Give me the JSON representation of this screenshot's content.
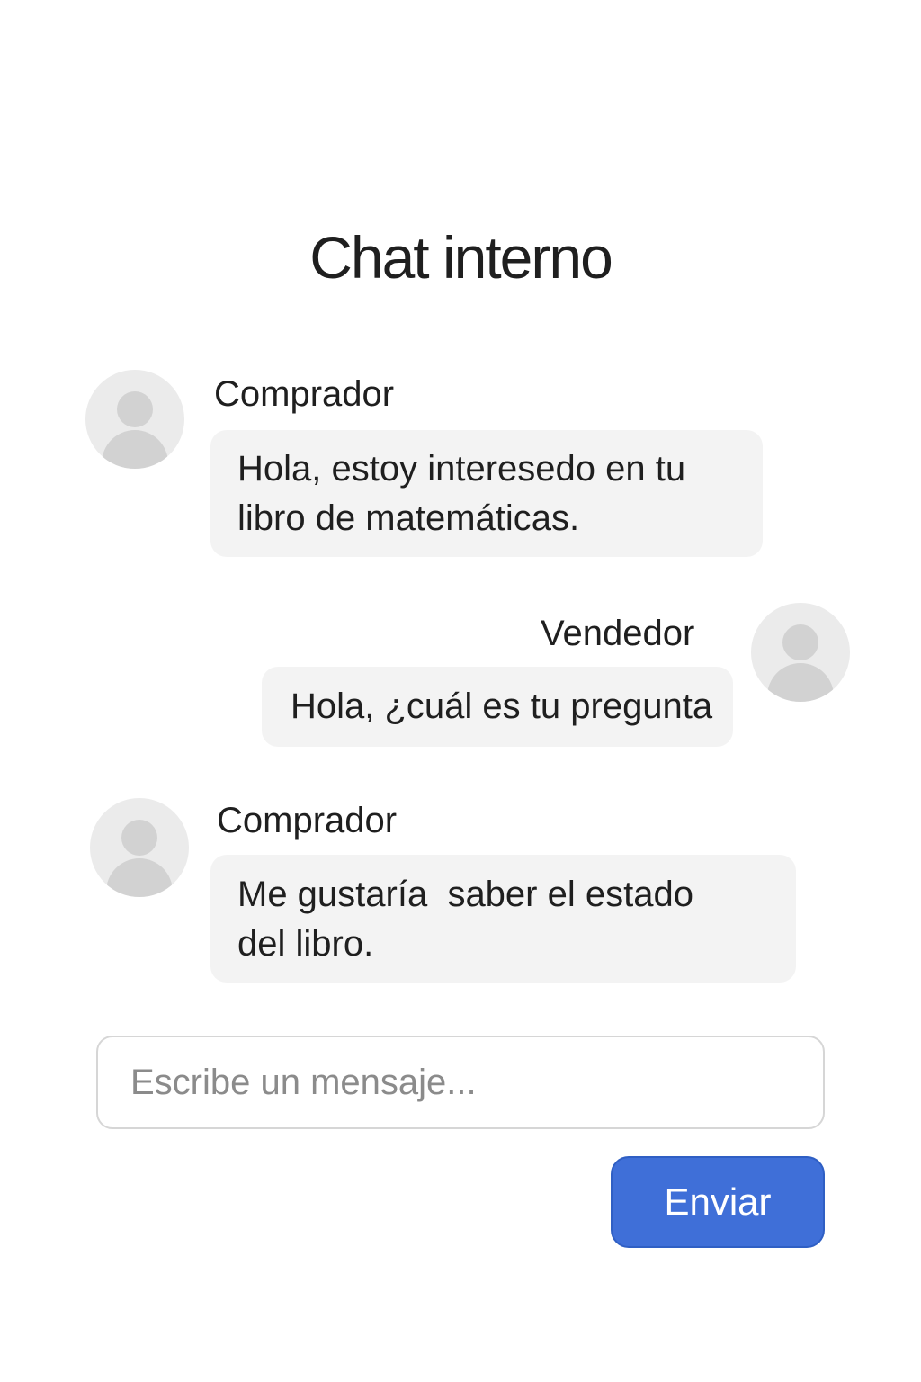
{
  "header": {
    "title": "Chat interno"
  },
  "messages": [
    {
      "sender": "Comprador",
      "side": "left",
      "lines": [
        "Hola, estoy interesedo en tu",
        "libro de matemáticas."
      ],
      "avatar_icon": "user-avatar-icon"
    },
    {
      "sender": "Vendedor",
      "side": "right",
      "lines": [
        "Hola, ¿cuál es tu pregunta"
      ],
      "avatar_icon": "user-avatar-icon"
    },
    {
      "sender": "Comprador",
      "side": "left",
      "lines": [
        "Me gustaría  saber el estado",
        "del libro."
      ],
      "avatar_icon": "user-avatar-icon"
    }
  ],
  "composer": {
    "placeholder": "Escribe un mensaje...",
    "value": "",
    "send_label": "Enviar"
  },
  "colors": {
    "accent": "#3f6fd8",
    "bubble": "#f3f3f3",
    "avatar_bg": "#ebebeb",
    "avatar_fg": "#d2d2d2",
    "text": "#1f1f1f"
  }
}
